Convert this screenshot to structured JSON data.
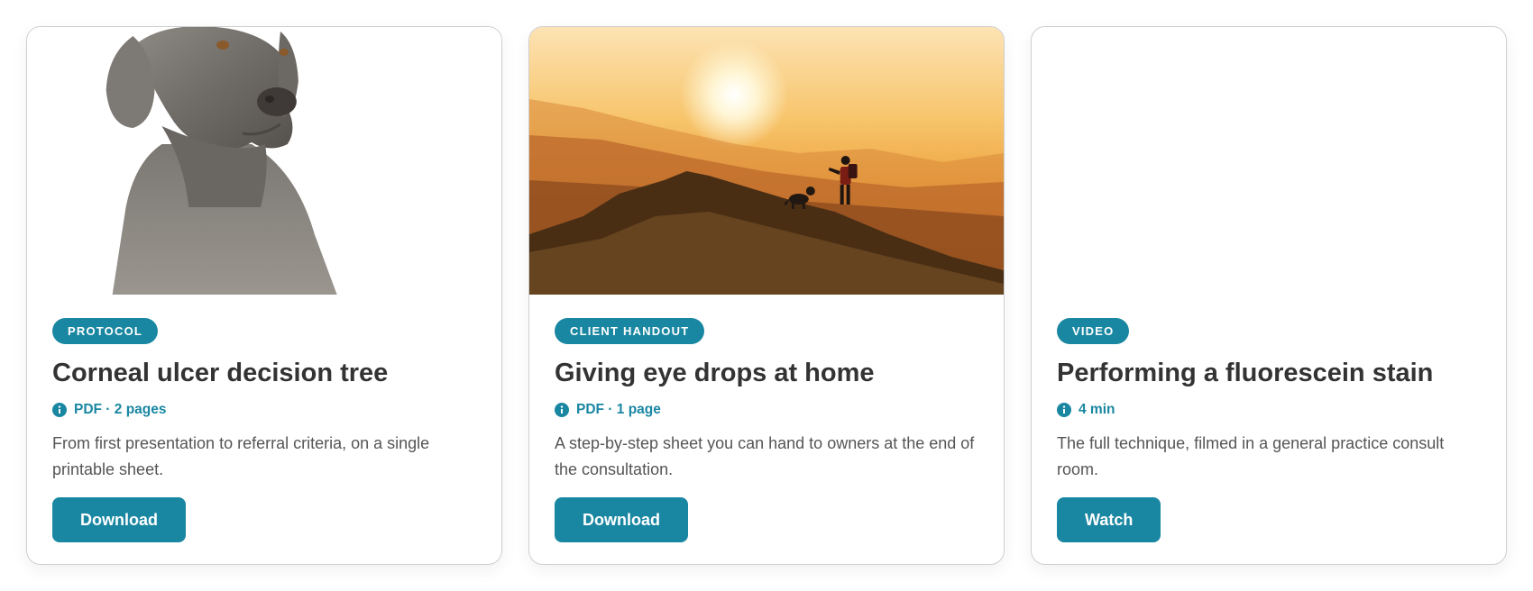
{
  "accent_color": "#1a87a2",
  "cards": [
    {
      "image": "weimaraner-dog-portrait",
      "badge": "PROTOCOL",
      "title": "Corneal ulcer decision tree",
      "meta": "PDF · 2 pages",
      "meta_icon": "info-icon",
      "description": "From first presentation to referral criteria, on a single printable sheet.",
      "button": "Download"
    },
    {
      "image": "sunset-hiker-with-dog-on-mountain",
      "badge": "CLIENT HANDOUT",
      "title": "Giving eye drops at home",
      "meta": "PDF · 1 page",
      "meta_icon": "info-icon",
      "description": "A step-by-step sheet you can hand to owners at the end of the consultation.",
      "button": "Download"
    },
    {
      "image": "video-thumbnail-blank",
      "badge": "VIDEO",
      "title": "Performing a fluorescein stain",
      "meta": "4 min",
      "meta_icon": "info-icon",
      "description": "The full technique, filmed in a general practice consult room.",
      "button": "Watch"
    }
  ]
}
